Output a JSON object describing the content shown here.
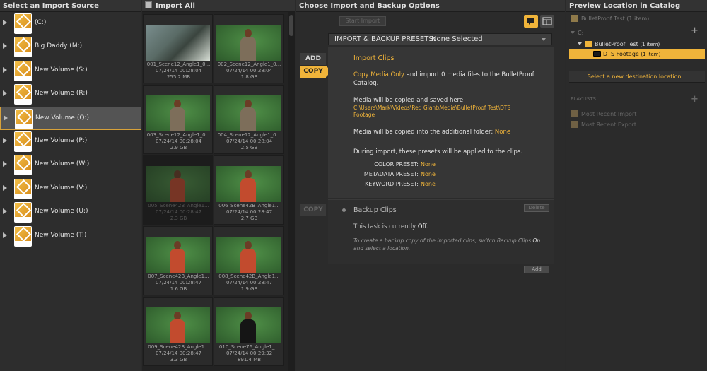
{
  "headers": {
    "sources": "Select an Import Source",
    "options": "Choose Import and Backup Options",
    "preview": "Preview Location in Catalog"
  },
  "import_all": "Import All",
  "sources": [
    {
      "label": "(C:)"
    },
    {
      "label": "Big Daddy (M:)"
    },
    {
      "label": "New Volume (S:)"
    },
    {
      "label": "New Volume (R:)"
    },
    {
      "label": "New Volume (Q:)",
      "selected": true
    },
    {
      "label": "New Volume (P:)"
    },
    {
      "label": "New Volume (W:)"
    },
    {
      "label": "New Volume (V:)"
    },
    {
      "label": "New Volume (U:)"
    },
    {
      "label": "New Volume (T:)"
    }
  ],
  "clips": [
    {
      "name": "001_Scene12_Angle1_0...",
      "date": "07/24/14 00:28:04",
      "size": "255.2 MB",
      "style": "office"
    },
    {
      "name": "002_Scene12_Angle1_0...",
      "date": "07/24/14 00:28:04",
      "size": "1.8 GB",
      "style": "green"
    },
    {
      "name": "003_Scene12_Angle1_0...",
      "date": "07/24/14 00:28:04",
      "size": "2.9 GB",
      "style": "green"
    },
    {
      "name": "004_Scene12_Angle1_0...",
      "date": "07/24/14 00:28:04",
      "size": "2.5 GB",
      "style": "green"
    },
    {
      "name": "005_Scene42B_Angle1...",
      "date": "07/24/14 00:28:47",
      "size": "2.3 GB",
      "style": "red",
      "dim": true
    },
    {
      "name": "006_Scene42B_Angle1...",
      "date": "07/24/14 00:28:47",
      "size": "2.7 GB",
      "style": "red"
    },
    {
      "name": "007_Scene42B_Angle1...",
      "date": "07/24/14 00:28:47",
      "size": "1.6 GB",
      "style": "red"
    },
    {
      "name": "008_Scene42B_Angle1...",
      "date": "07/24/14 00:28:47",
      "size": "1.9 GB",
      "style": "red"
    },
    {
      "name": "009_Scene42B_Angle1...",
      "date": "07/24/14 00:28:47",
      "size": "3.3 GB",
      "style": "red"
    },
    {
      "name": "010_Scene76_Angle1_...",
      "date": "07/24/14 00:29:32",
      "size": "891.4 MB",
      "style": "black"
    }
  ],
  "options": {
    "start_import": "Start Import",
    "presets_label": "IMPORT & BACKUP PRESETS:",
    "presets_value": "None Selected",
    "add_tab": "ADD",
    "copy_tab": "COPY",
    "import_title": "Import Clips",
    "copy_media_only": "Copy Media Only",
    "import_line1_rest": " and import 0 media files to the BulletProof",
    "import_line2": "Catalog.",
    "saved_here_label": "Media will be copied and saved here:",
    "path_line1": "C:\\Users\\Mark\\Videos\\Red Giant\\Media\\BulletProof Test\\DTS",
    "path_line2": "Footage",
    "additional_folder_label": "Media will be copied into the additional folder: ",
    "additional_folder_value": "None",
    "presets_applied_label": "During import, these presets will be applied to the clips.",
    "color_preset_label": "COLOR PRESET:",
    "color_preset_value": "None",
    "metadata_preset_label": "METADATA PRESET:",
    "metadata_preset_value": "None",
    "keyword_preset_label": "KEYWORD PRESET:",
    "keyword_preset_value": "None",
    "copy_tab_disabled": "COPY",
    "backup_title": "Backup Clips",
    "delete_button": "Delete",
    "backup_status_prefix": "This task is currently ",
    "backup_status_value": "Off",
    "backup_status_suffix": ".",
    "backup_hint_1": "To create a backup copy of the imported clips, switch Backup Clips ",
    "backup_hint_on": "On",
    "backup_hint_2": "and select a location.",
    "add_button": "Add"
  },
  "preview": {
    "catalog_name": "BulletProof Test (1 item)",
    "drive": "C:",
    "folder_name": "BulletProof Test",
    "folder_count": "(1 item)",
    "subfolder_name": "DTS Footage",
    "subfolder_count": "(1 item)",
    "select_destination": "Select a new destination location...",
    "playlists_label": "PLAYLISTS",
    "playlists": [
      "Most Recent Import",
      "Most Recent Export"
    ]
  },
  "colors": {
    "accent": "#f0b43a",
    "selected_row": "#545454"
  }
}
